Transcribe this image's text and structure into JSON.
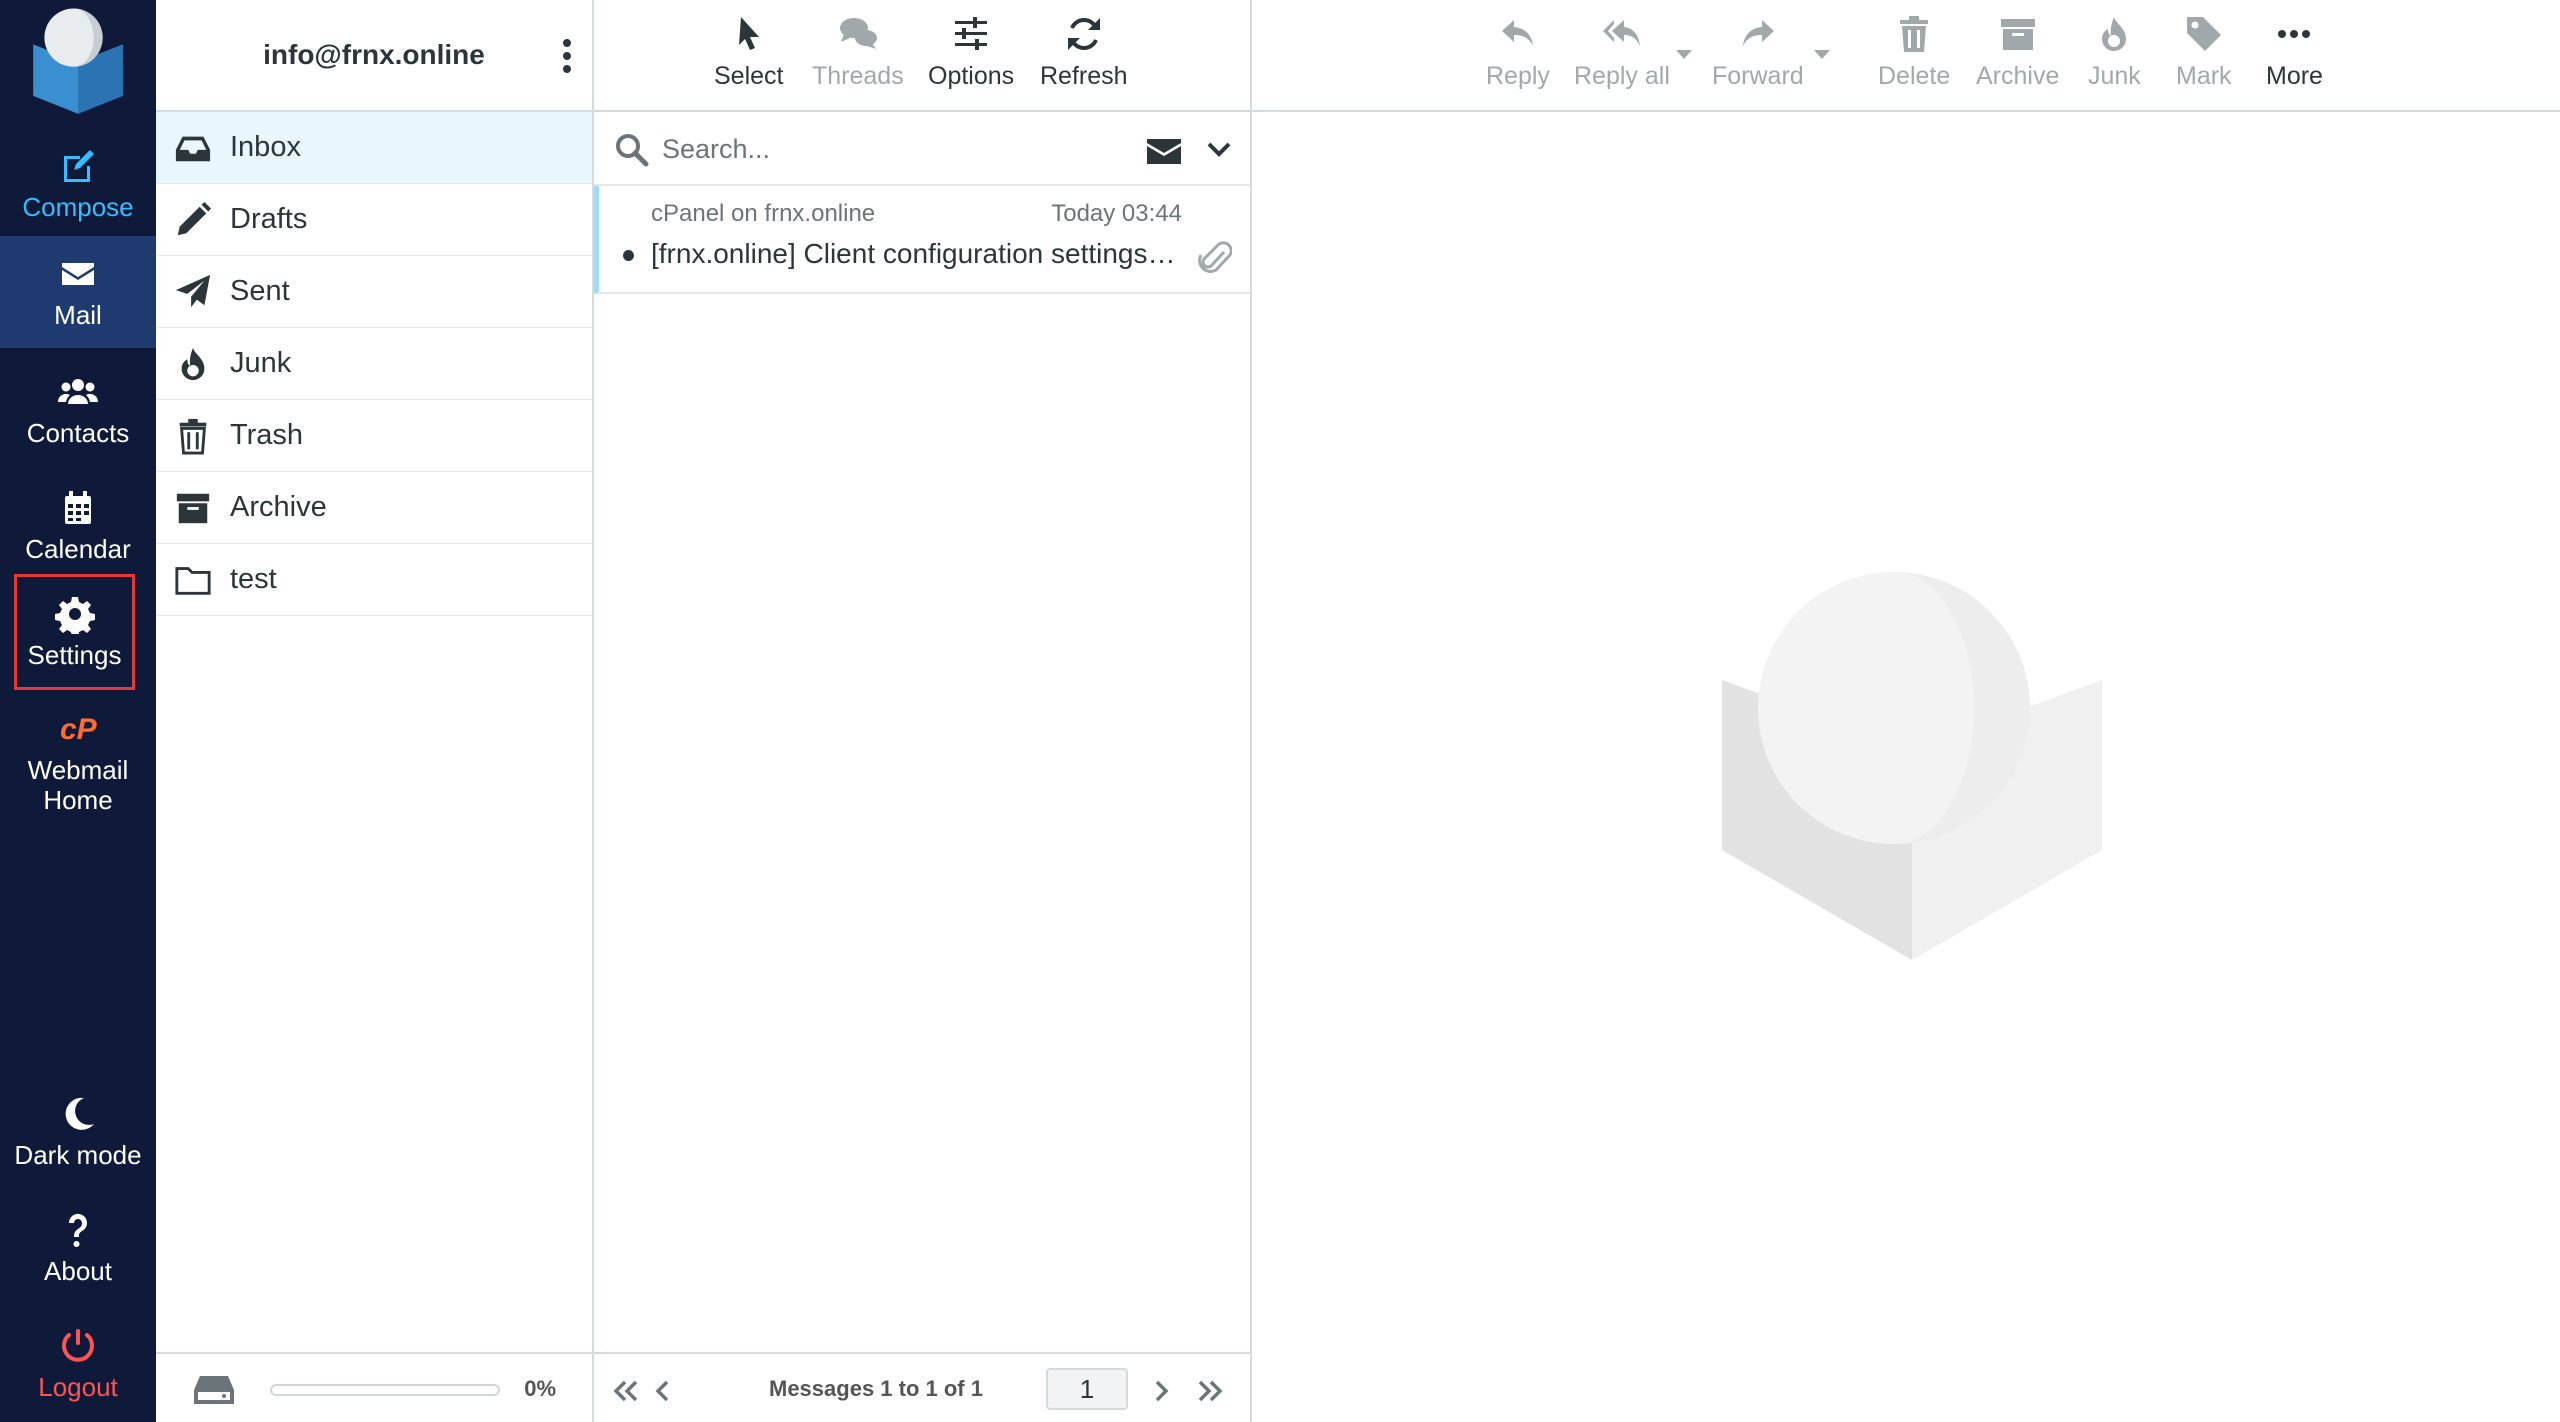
{
  "nav": {
    "compose": "Compose",
    "mail": "Mail",
    "contacts": "Contacts",
    "calendar": "Calendar",
    "settings": "Settings",
    "webmail_home_1": "Webmail",
    "webmail_home_2": "Home",
    "dark_mode": "Dark mode",
    "about": "About",
    "logout": "Logout"
  },
  "account": "info@frnx.online",
  "folders": [
    {
      "label": "Inbox",
      "icon": "inbox-icon"
    },
    {
      "label": "Drafts",
      "icon": "pencil-icon"
    },
    {
      "label": "Sent",
      "icon": "paper-plane-icon"
    },
    {
      "label": "Junk",
      "icon": "fire-icon"
    },
    {
      "label": "Trash",
      "icon": "trash-icon"
    },
    {
      "label": "Archive",
      "icon": "archive-icon"
    },
    {
      "label": "test",
      "icon": "folder-icon"
    }
  ],
  "quota": {
    "text": "0%",
    "fraction": 0
  },
  "list_toolbar": {
    "select": "Select",
    "threads": "Threads",
    "options": "Options",
    "refresh": "Refresh"
  },
  "search": {
    "placeholder": "Search..."
  },
  "messages": [
    {
      "from": "cPanel on frnx.online",
      "date": "Today 03:44",
      "subject": "[frnx.online] Client configuration settings for “info@frnx.online”."
    }
  ],
  "pager": {
    "count_text": "Messages 1 to 1 of 1",
    "page": "1"
  },
  "content_toolbar": {
    "reply": "Reply",
    "reply_all": "Reply all",
    "forward": "Forward",
    "delete": "Delete",
    "archive": "Archive",
    "junk": "Junk",
    "mark": "Mark",
    "more": "More"
  },
  "colors": {
    "nav_bg": "#0f1a3a",
    "accent": "#37beff",
    "logout": "#ff5552",
    "selection_highlight": "#e53935"
  }
}
